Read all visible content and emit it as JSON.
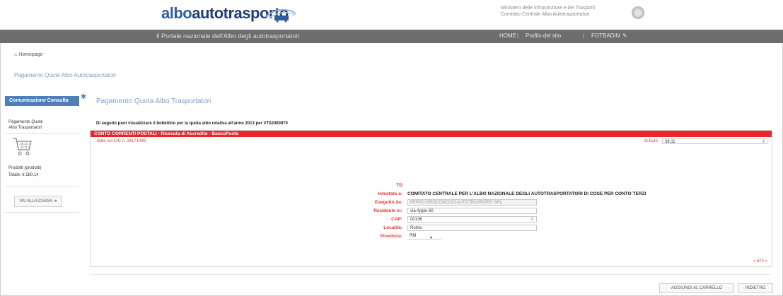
{
  "header": {
    "logo_part1": "albo",
    "logo_part2": "autotrasporto",
    "ministry_line1": "Ministero delle Infrastrutture e dei Trasporti",
    "ministry_line2": "Comitato Centrale Albo Autotrasportatori"
  },
  "topbar": {
    "portal_text": "Il Portale nazionale dell'Albo degli autotrasportatori",
    "menu_home": "HOME",
    "menu_profile": "Profilo del sito",
    "menu_user": "FOTBADIN"
  },
  "breadcrumb": {
    "home": "Homepage",
    "link": "Pagamento Quote Albo Autotrasportatori"
  },
  "sidebar": {
    "tab_label": "Comunicazione Consulta",
    "item_line1": "Pagamento Quote",
    "item_line2": "Albo Trasportatori",
    "products": "Prodotti (prodotti)",
    "total": "Totale: € 580,14",
    "cart_button": "VAI ALLA CASSA"
  },
  "main": {
    "title": "Pagamento Quota Albo Trasportatori",
    "notice": "Di seguito puoi visualizzare il bollettino per la quota albo relativa all'anno 2013 per VT02000970",
    "panel_header": "CONTO CORRENTI POSTALI - Ricevuta di Accredito - BancoPosta",
    "ccp_line": "Dato sul C/C n. 34171089",
    "euro_label": "di Euro",
    "euro_value": "38,11"
  },
  "form": {
    "td_label": "TD",
    "intestato_label": "Intestato a:",
    "intestato_value": "COMITATO CENTRALE PER L'ALBO NAZIONALE DEGLI AUTOTRASPORTATORI DI COSE PER CONTO TERZI",
    "eseguito_label": "Eseguito da:",
    "eseguito_value": "PEPPO GROCCOCCIO AUTOTRASPORTI SRL",
    "residente_label": "Residente in:",
    "residente_value": "via Appio 60",
    "cap_label": "CAP:",
    "cap_value": "00136",
    "localita_label": "Località:",
    "localita_value": "Roma",
    "provincia_label": "Provincia:",
    "provincia_value": "RM",
    "pager": "« 674 »"
  },
  "actions": {
    "add_to_cart": "AGGIUNGI AL CARRELLO",
    "back": "INDIETRO"
  },
  "colors": {
    "brand_blue": "#2f5f9e",
    "header_red": "#e8262b",
    "topbar_gray": "#6d6d6d"
  }
}
